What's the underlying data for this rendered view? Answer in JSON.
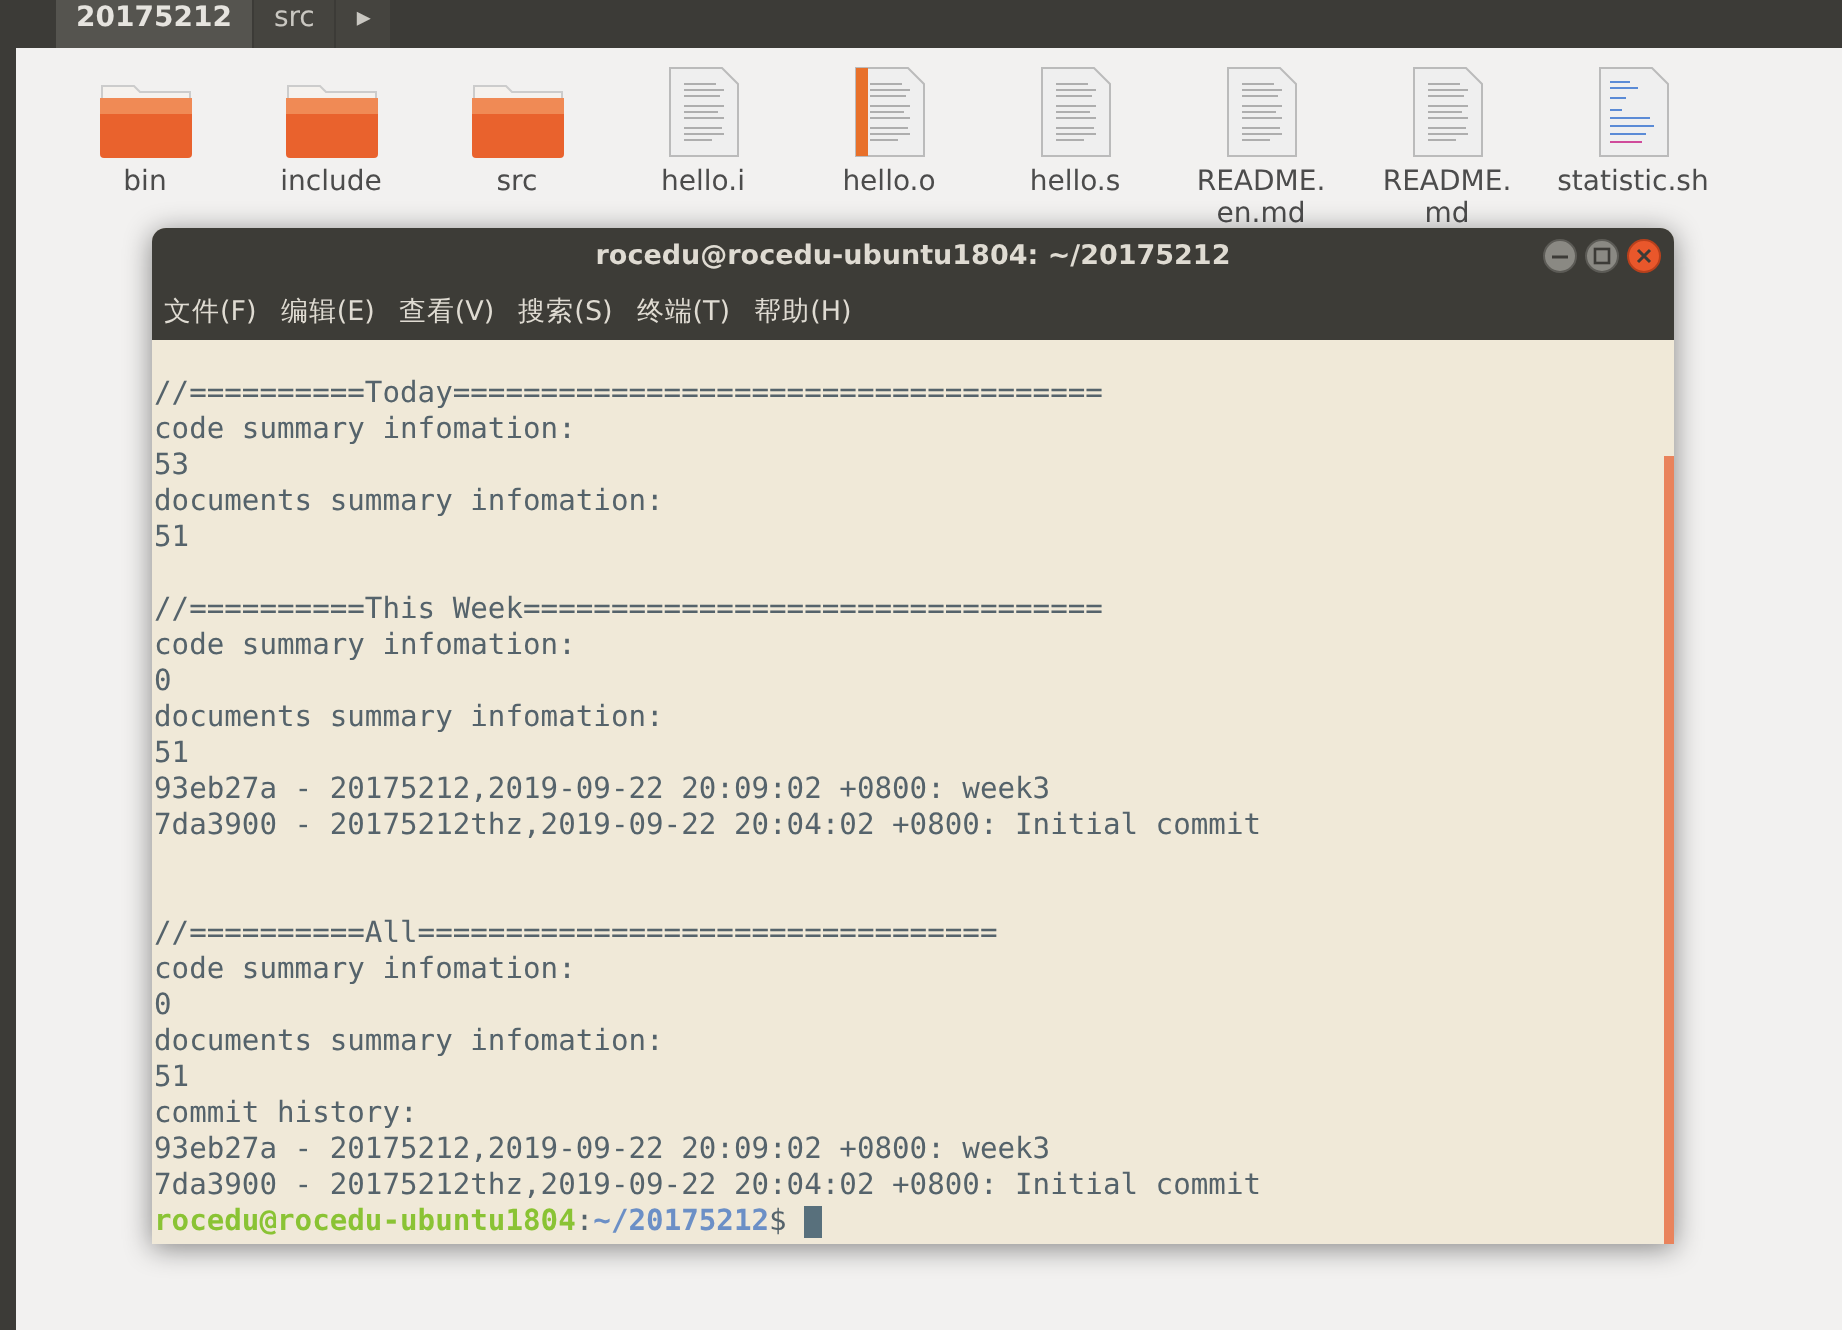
{
  "breadcrumbs": [
    {
      "label": "20175212",
      "selected": true
    },
    {
      "label": "src",
      "selected": false
    },
    {
      "label": "▸",
      "selected": false
    }
  ],
  "files": [
    {
      "name": "bin",
      "kind": "folder"
    },
    {
      "name": "include",
      "kind": "folder"
    },
    {
      "name": "src",
      "kind": "folder"
    },
    {
      "name": "hello.i",
      "kind": "text"
    },
    {
      "name": "hello.o",
      "kind": "binary"
    },
    {
      "name": "hello.s",
      "kind": "text"
    },
    {
      "name": "README.\nen.md",
      "kind": "text"
    },
    {
      "name": "README.\nmd",
      "kind": "text"
    },
    {
      "name": "statistic.sh",
      "kind": "script"
    }
  ],
  "terminal": {
    "title": "rocedu@rocedu-ubuntu1804: ~/20175212",
    "menu": [
      "文件(F)",
      "编辑(E)",
      "查看(V)",
      "搜索(S)",
      "终端(T)",
      "帮助(H)"
    ],
    "lines": [
      {
        "kind": "text",
        "text": "//==========Today====================================="
      },
      {
        "kind": "text",
        "text": "code summary infomation:"
      },
      {
        "kind": "text",
        "text": "53"
      },
      {
        "kind": "text",
        "text": "documents summary infomation:"
      },
      {
        "kind": "text",
        "text": "51"
      },
      {
        "kind": "blank"
      },
      {
        "kind": "text",
        "text": "//==========This Week================================="
      },
      {
        "kind": "text",
        "text": "code summary infomation:"
      },
      {
        "kind": "text",
        "text": "0"
      },
      {
        "kind": "text",
        "text": "documents summary infomation:"
      },
      {
        "kind": "text",
        "text": "51"
      },
      {
        "kind": "text",
        "text": "93eb27a - 20175212,2019-09-22 20:09:02 +0800: week3"
      },
      {
        "kind": "text",
        "text": "7da3900 - 20175212thz,2019-09-22 20:04:02 +0800: Initial commit"
      },
      {
        "kind": "blank"
      },
      {
        "kind": "blank"
      },
      {
        "kind": "text",
        "text": "//==========All================================="
      },
      {
        "kind": "text",
        "text": "code summary infomation:"
      },
      {
        "kind": "text",
        "text": "0"
      },
      {
        "kind": "text",
        "text": "documents summary infomation:"
      },
      {
        "kind": "text",
        "text": "51"
      },
      {
        "kind": "text",
        "text": "commit history:"
      },
      {
        "kind": "text",
        "text": "93eb27a - 20175212,2019-09-22 20:09:02 +0800: week3"
      },
      {
        "kind": "text",
        "text": "7da3900 - 20175212thz,2019-09-22 20:04:02 +0800: Initial commit"
      },
      {
        "kind": "prompt",
        "user": "rocedu@rocedu-ubuntu1804",
        "sep": ":",
        "path": "~/20175212",
        "symbol": "$"
      }
    ]
  }
}
